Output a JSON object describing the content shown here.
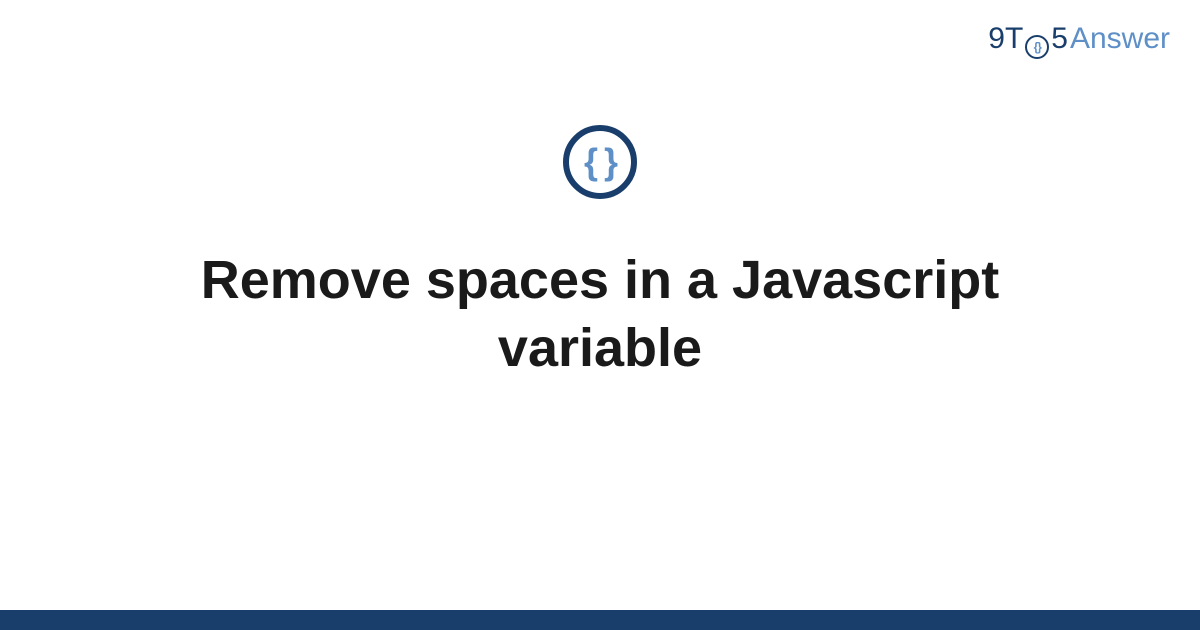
{
  "logo": {
    "nine": "9",
    "t": "T",
    "circle_inner": "{}",
    "five": "5",
    "answer": "Answer"
  },
  "category_icon": {
    "braces": "{ }"
  },
  "title": "Remove spaces in a Javascript variable",
  "colors": {
    "primary_dark": "#1a3e6b",
    "primary_light": "#5e8fc7",
    "text": "#1a1a1a",
    "background": "#ffffff"
  }
}
